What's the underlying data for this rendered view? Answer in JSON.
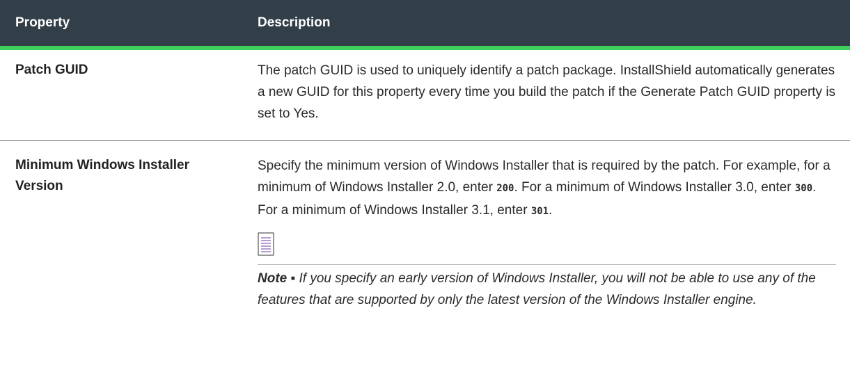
{
  "header": {
    "col1": "Property",
    "col2": "Description"
  },
  "rows": [
    {
      "property": "Patch GUID",
      "description": "The patch GUID is used to uniquely identify a patch package. InstallShield automatically generates a new GUID for this property every time you build the patch if the Generate Patch GUID property is set to Yes."
    },
    {
      "property_line1": "Minimum Windows Installer",
      "property_line2": "Version",
      "desc_part1": "Specify the minimum version of Windows Installer that is required by the patch. For example, for a minimum of Windows Installer 2.0, enter ",
      "code1": "200",
      "desc_part2": ". For a minimum of Windows Installer 3.0, enter ",
      "code2": "300",
      "desc_part3": ". For a minimum of Windows Installer 3.1, enter ",
      "code3": "301",
      "desc_part4": ".",
      "note_icon": "note-icon",
      "note_label": "Note ▪",
      "note_text": " If you specify an early version of Windows Installer, you will not be able to use any of the features that are supported by only the latest version of the Windows Installer engine."
    }
  ],
  "colors": {
    "header_bg": "#323e48",
    "header_accent": "#3ecf5a",
    "icon_stroke": "#6b3fa0"
  }
}
